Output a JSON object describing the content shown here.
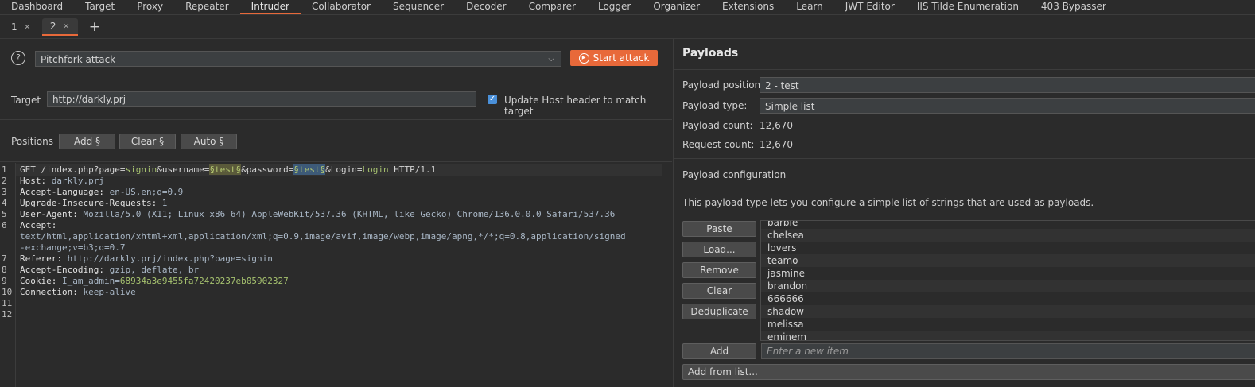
{
  "nav": [
    "Dashboard",
    "Target",
    "Proxy",
    "Repeater",
    "Intruder",
    "Collaborator",
    "Sequencer",
    "Decoder",
    "Comparer",
    "Logger",
    "Organizer",
    "Extensions",
    "Learn",
    "JWT Editor",
    "IIS Tilde Enumeration",
    "403 Bypasser"
  ],
  "nav_active": "Intruder",
  "subtabs": [
    {
      "label": "1",
      "close": "×"
    },
    {
      "label": "2",
      "close": "×"
    }
  ],
  "add_tab": "+",
  "attack": {
    "help": "?",
    "type": "Pitchfork attack",
    "chevron": "⌵",
    "start_label": "Start attack"
  },
  "target": {
    "label": "Target",
    "url": "http://darkly.prj",
    "update_label": "Update Host header to match target",
    "checked": true
  },
  "positions": {
    "label": "Positions",
    "add": "Add §",
    "clear": "Clear §",
    "auto": "Auto §"
  },
  "request": {
    "line1": {
      "pre1": "GET /index.php?page=",
      "page": "signin",
      "pre2": "&username=",
      "m1": "§test§",
      "pre3": "&password=",
      "m2": "§test§",
      "pre4": "&Login=",
      "login": "Login",
      "post": " HTTP/1.1"
    },
    "lines": [
      {
        "k": "Host:",
        "v": " darkly.prj"
      },
      {
        "k": "Accept-Language:",
        "v": " en-US,en;q=0.9"
      },
      {
        "k": "Upgrade-Insecure-Requests:",
        "v": " 1"
      },
      {
        "k": "User-Agent:",
        "v": " Mozilla/5.0 (X11; Linux x86_64) AppleWebKit/537.36 (KHTML, like Gecko) Chrome/136.0.0.0 Safari/537.36"
      },
      {
        "k": "Accept:",
        "v": ""
      },
      {
        "k": "",
        "v": "text/html,application/xhtml+xml,application/xml;q=0.9,image/avif,image/webp,image/apng,*/*;q=0.8,application/signed"
      },
      {
        "k": "",
        "v": "-exchange;v=b3;q=0.7"
      },
      {
        "k": "Referer:",
        "v": " http://darkly.prj/index.php?page=signin"
      },
      {
        "k": "Accept-Encoding:",
        "v": " gzip, deflate, br"
      },
      {
        "k": "Cookie:",
        "v": " I_am_admin=",
        "g": "68934a3e9455fa72420237eb05902327"
      },
      {
        "k": "Connection:",
        "v": " keep-alive"
      }
    ],
    "line_numbers": [
      "1",
      "2",
      "3",
      "4",
      "5",
      "6",
      "",
      "",
      "7",
      "8",
      "9",
      "10",
      "11",
      "12"
    ]
  },
  "payloads": {
    "title": "Payloads",
    "position_label": "Payload position:",
    "position_value": "2 - test",
    "type_label": "Payload type:",
    "type_value": "Simple list",
    "count_label": "Payload count:",
    "count_value": "12,670",
    "request_label": "Request count:",
    "request_value": "12,670",
    "config_title": "Payload configuration",
    "config_desc": "This payload type lets you configure a simple list of strings that are used as payloads.",
    "buttons": {
      "paste": "Paste",
      "load": "Load...",
      "remove": "Remove",
      "clear": "Clear",
      "dedupe": "Deduplicate",
      "add": "Add",
      "add_from_list": "Add from list..."
    },
    "new_item_placeholder": "Enter a new item",
    "items": [
      "barbie",
      "chelsea",
      "lovers",
      "teamo",
      "jasmine",
      "brandon",
      "666666",
      "shadow",
      "melissa",
      "eminem"
    ]
  }
}
